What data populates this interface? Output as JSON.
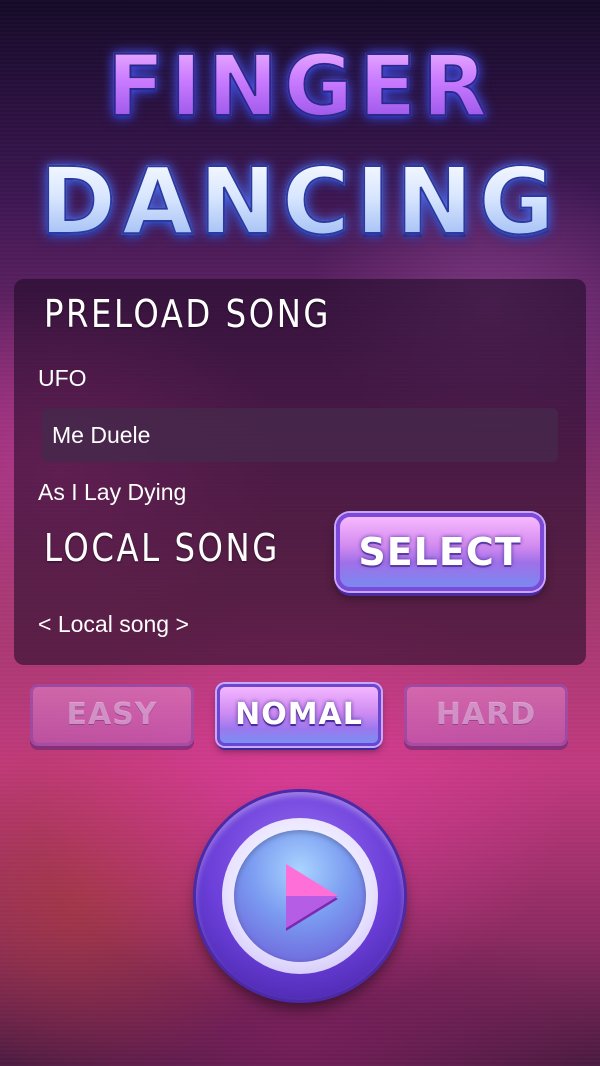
{
  "app": {
    "title_line1": "FINGER",
    "title_line2": "DANCING"
  },
  "preload": {
    "heading": "PRELOAD SONG",
    "songs": [
      "UFO",
      "Me Duele",
      "As I Lay Dying"
    ],
    "selected_song": "Me Duele"
  },
  "local": {
    "heading": "LOCAL SONG",
    "select_label": "SELECT",
    "current": "< Local song >"
  },
  "difficulty": {
    "options": [
      "EASY",
      "NOMAL",
      "HARD"
    ],
    "selected": "NOMAL"
  },
  "play": {
    "icon": "play-icon"
  },
  "colors": {
    "accent_purple": "#7b4ad8",
    "button_pink": "#d48cf0",
    "panel_bg": "#190a23"
  }
}
